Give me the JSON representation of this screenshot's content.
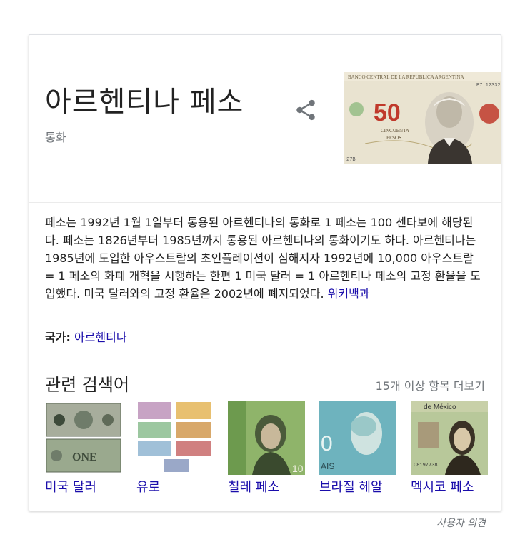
{
  "entity": {
    "title": "아르헨티나 페소",
    "subtitle": "통화"
  },
  "share": {
    "icon": "share-icon"
  },
  "banknote": {
    "denomination": "50",
    "header": "BANCO CENTRAL DE LA REPUBLICA ARGENTINA",
    "word": "CINCUENTA",
    "unit": "PESOS",
    "serial": "B7.12332"
  },
  "description": {
    "text": "페소는 1992년 1월 1일부터 통용된 아르헨티나의 통화로 1 페소는 100 센타보에 해당된다. 페소는 1826년부터 1985년까지 통용된 아르헨티나의 통화이기도 하다. 아르헨티나는 1985년에 도입한 아우스트랄의 초인플레이션이 심해지자 1992년에 10,000 아우스트랄 = 1 페소의 화폐 개혁을 시행하는 한편 1 미국 달러 = 1 아르헨티나 페소의 고정 환율을 도입했다. 미국 달러와의 고정 환율은 2002년에 폐지되었다.",
    "source_link": "위키백과"
  },
  "country": {
    "label": "국가:",
    "value": "아르헨티나"
  },
  "related": {
    "title": "관련 검색어",
    "more": "15개 이상 항목 더보기",
    "items": [
      {
        "label": "미국 달러"
      },
      {
        "label": "유로"
      },
      {
        "label": "칠레 페소"
      },
      {
        "label": "브라질 헤알"
      },
      {
        "label": "멕시코 페소",
        "banner": "de México"
      }
    ],
    "colors": {
      "usd": "#6f7c6a",
      "eur": "#c8b88a",
      "clp": "#7ea05a",
      "brl": "#5aa0b0",
      "mxn": "#8aa86a"
    }
  },
  "feedback": {
    "label": "사용자 의견"
  },
  "colors": {
    "link": "#1a0dab",
    "muted": "#70757a",
    "text": "#222222"
  }
}
